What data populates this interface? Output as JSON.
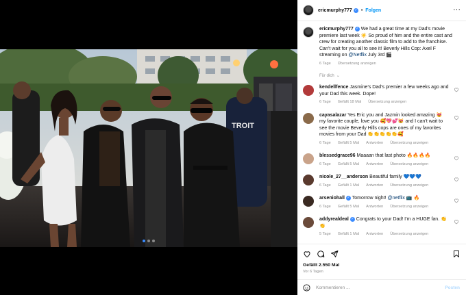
{
  "header": {
    "username": "ericmurphy777",
    "separator": "•",
    "follow_label": "Folgen",
    "more_icon": "more-horizontal-icon"
  },
  "caption": {
    "username": "ericmurphy777",
    "text_part1": " We had a great time at my Dad’s movie premiere last week ",
    "emoji1": "☀️",
    "text_part2": " So proud of him and the entire cast and crew for creating another classic film to add to the franchise. Can’t wait for you all to see it! Beverly Hills Cop: Axel F streaming on ",
    "mention": "@Netflix",
    "text_part3": " July 3rd ",
    "emoji2": "🎬",
    "age": "6 Tage",
    "translate": "Übersetzung anzeigen"
  },
  "hidden_comments": "Für dich",
  "comments": [
    {
      "user": "kendellfence",
      "text": " Jasmine’s Dad’s premier a few weeks ago and your Dad this week. Dope!",
      "age": "6 Tage",
      "likes": "Gefällt 18 Mal",
      "reply": "Antworten",
      "translate": "Übersetzung anzeigen",
      "avatar_color": "#b23a3a"
    },
    {
      "user": "cayasalazar",
      "text": " Yes Eric you and Jazmin looked amazing 😻 my favorite couple, love you 🥰💖💕😻 and I can’t wait to see the movie Beverly Hills cops are ones of my favorites movies from your Dad 👏👏👏👏👏🥰",
      "age": "6 Tage",
      "likes": "Gefällt 5 Mal",
      "reply": "Antworten",
      "translate": "Übersetzung anzeigen",
      "avatar_color": "#8a6a4a"
    },
    {
      "user": "blessedgrace96",
      "text": " Maaaan that last photo 🔥🔥🔥🔥",
      "age": "6 Tage",
      "likes": "Gefällt 5 Mal",
      "reply": "Antworten",
      "translate": "Übersetzung anzeigen",
      "avatar_color": "#c9a38a"
    },
    {
      "user": "nicole_27__anderson",
      "text": " Beautiful family 💙💙💙",
      "age": "6 Tage",
      "likes": "Gefällt 1 Mal",
      "reply": "Antworten",
      "translate": "Übersetzung anzeigen",
      "avatar_color": "#5a3a2e"
    },
    {
      "user": "arseniohall",
      "text": " Tomorrow night! ",
      "mention": "@netflix",
      "text2": " 📺 🔥",
      "age": "6 Tage",
      "likes": "Gefällt 5 Mal",
      "reply": "Antworten",
      "translate": "Übersetzung anzeigen",
      "avatar_color": "#3a2a22"
    },
    {
      "user": "addyrealdeal",
      "text": " Congrats to your Dad! I’m a HUGE fan. 👏👏",
      "age": "5 Tage",
      "likes": "Gefällt 1 Mal",
      "reply": "Antworten",
      "translate": "Übersetzung anzeigen",
      "avatar_color": "#6a4a3a"
    }
  ],
  "actions": {
    "likes": "Gefällt 2.550 Mal",
    "date": "Vor 6 Tagen",
    "icons": [
      "heart-icon",
      "comment-icon",
      "share-icon",
      "bookmark-icon"
    ]
  },
  "comment_bar": {
    "placeholder": "Kommentieren ...",
    "post_label": "Posten",
    "emoji_icon": "emoji-icon"
  },
  "carousel": {
    "count": 3,
    "active_index": 0
  },
  "colors": {
    "accent": "#0095f6",
    "verified": "#3b8cff",
    "muted": "#8e8e8e",
    "link": "#00376b"
  }
}
